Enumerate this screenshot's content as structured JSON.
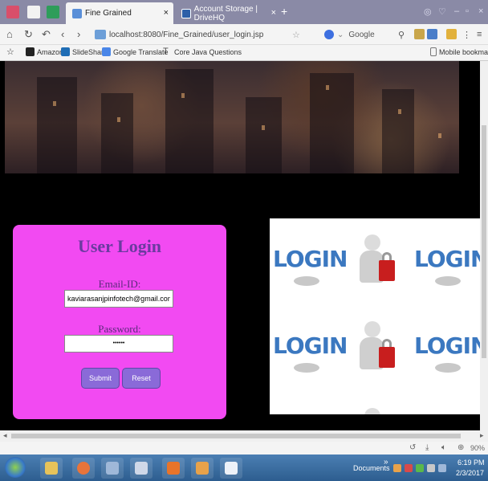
{
  "browser": {
    "tabs": [
      {
        "label": "Fine Grained",
        "active": true
      },
      {
        "label": "Account Storage | DriveHQ",
        "active": false
      }
    ],
    "new_tab_glyph": "+",
    "close_glyph": "×",
    "url": "localhost:8080/Fine_Grained/user_login.jsp",
    "search_engine": "Google",
    "bookmarks": [
      {
        "label": "Amazon",
        "icon": "amazon-icon",
        "color": "#222222"
      },
      {
        "label": "SlideShare",
        "icon": "linkedin-icon",
        "color": "#1f6db5"
      },
      {
        "label": "Google Translate",
        "icon": "translate-icon",
        "color": "#4a86e8"
      },
      {
        "label": "Core Java Questions",
        "icon": "text-icon",
        "color": "#555555"
      }
    ],
    "mobile_bookmarks": "Mobile bookmarks",
    "zoom": "90%"
  },
  "login": {
    "title": "User Login",
    "email_label": "Email-ID:",
    "email_value": "kaviarasanjpinfotech@gmail.com",
    "password_label": "Password:",
    "password_value": "••••••",
    "submit_label": "Submit",
    "reset_label": "Reset"
  },
  "image_panel": {
    "word": "LOGIN"
  },
  "taskbar": {
    "documents_label": "Documents",
    "overflow_glyph": "»",
    "time": "6:19 PM",
    "date": "2/3/2017"
  },
  "colors": {
    "login_bg": "#f24af2",
    "title": "#6b3aa0",
    "button": "#8a6ad8",
    "tabstrip": "#8a8aa6"
  }
}
